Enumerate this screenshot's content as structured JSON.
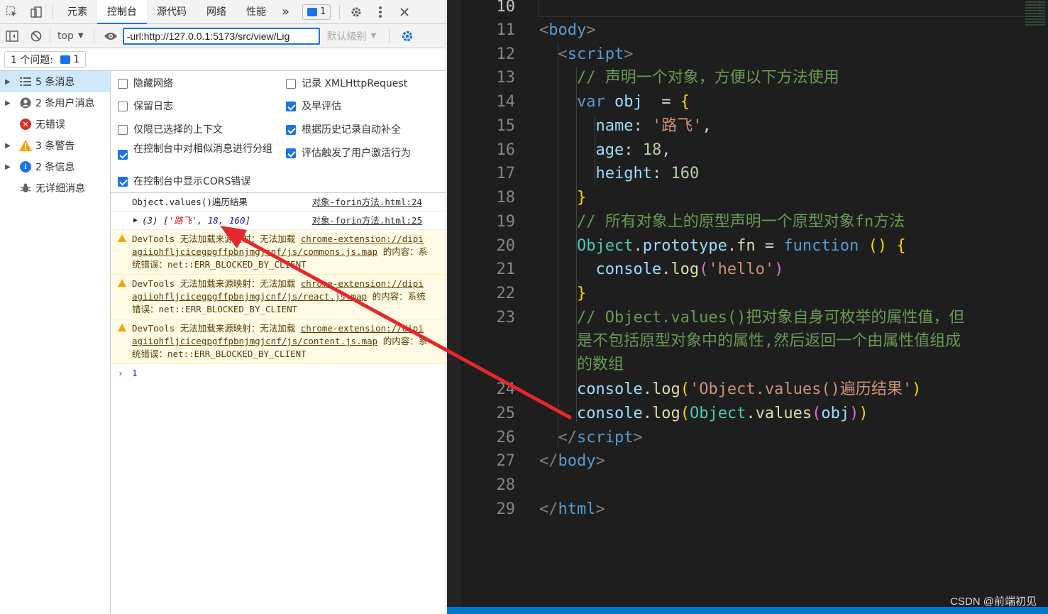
{
  "devtools": {
    "tabs": [
      "元素",
      "控制台",
      "源代码",
      "网络",
      "性能"
    ],
    "active_tab": "控制台",
    "more_tabs": "»",
    "message_badge_count": "1",
    "context": "top",
    "filter_value": "-url:http://127.0.0.1:5173/src/view/Lig",
    "level_label": "默认级别",
    "issues_label": "1 个问题:",
    "issues_count": "1",
    "sidebar": [
      {
        "label": "5 条消息",
        "icon": "list-icon",
        "expandable": true,
        "selected": true
      },
      {
        "label": "2 条用户消息",
        "icon": "user-icon",
        "expandable": true,
        "selected": false
      },
      {
        "label": "无错误",
        "icon": "error-icon",
        "expandable": false,
        "selected": false
      },
      {
        "label": "3 条警告",
        "icon": "warning-icon",
        "expandable": true,
        "selected": false
      },
      {
        "label": "2 条信息",
        "icon": "info-icon",
        "expandable": true,
        "selected": false
      },
      {
        "label": "无详细消息",
        "icon": "bug-icon",
        "expandable": false,
        "selected": false
      }
    ],
    "settings": [
      {
        "label": "隐藏网络",
        "checked": false
      },
      {
        "label": "记录 XMLHttpRequest",
        "checked": false
      },
      {
        "label": "保留日志",
        "checked": false
      },
      {
        "label": "及早评估",
        "checked": true
      },
      {
        "label": "仅限已选择的上下文",
        "checked": false
      },
      {
        "label": "根据历史记录自动补全",
        "checked": true
      },
      {
        "label": "在控制台中对相似消息进行分组",
        "checked": true
      },
      {
        "label": "评估触发了用户激活行为",
        "checked": true
      },
      {
        "label": "在控制台中显示CORS错误",
        "checked": true
      }
    ],
    "console": {
      "log1": {
        "text": "Object.values()遍历结果",
        "source": "对象-forin方法.html:24"
      },
      "log2": {
        "count": "(3)",
        "open": "[",
        "s1": "'路飞'",
        "comma1": ",",
        "n1": "18",
        "comma2": ",",
        "n2": "160",
        "close": "]",
        "source": "对象-forin方法.html:25"
      },
      "warnings": [
        {
          "prefix": "DevTools 无法加载来源映射：无法加载 ",
          "url": "chrome-extension://dipiagiiohfljcicegpgffpbnjmgjcnf/js/commons.js.map",
          "suffix": " 的内容：系统错误：net::ERR_BLOCKED_BY_CLIENT"
        },
        {
          "prefix": "DevTools 无法加载来源映射：无法加载 ",
          "url": "chrome-extension://dipiagiiohfljcicegpgffpbnjmgjcnf/js/react.js.map",
          "suffix": " 的内容：系统错误：net::ERR_BLOCKED_BY_CLIENT"
        },
        {
          "prefix": "DevTools 无法加载来源映射：无法加载 ",
          "url": "chrome-extension://dipiagiiohfljcicegpgffpbnjmgjcnf/js/content.js.map",
          "suffix": " 的内容：系统错误：net::ERR_BLOCKED_BY_CLIENT"
        }
      ],
      "prompt": "›",
      "prompt_value": "1"
    }
  },
  "editor": {
    "lines": [
      {
        "n": "10",
        "segs": []
      },
      {
        "n": "11",
        "segs": [
          [
            "c-tag",
            "<"
          ],
          [
            "c-tagname",
            "body"
          ],
          [
            "c-tag",
            ">"
          ]
        ]
      },
      {
        "n": "12",
        "segs": [
          [
            "c-tag",
            "  <"
          ],
          [
            "c-tagname",
            "script"
          ],
          [
            "c-tag",
            ">"
          ]
        ]
      },
      {
        "n": "13",
        "segs": [
          [
            "c-com",
            "    // 声明一个对象，方便以下方法使用"
          ]
        ]
      },
      {
        "n": "14",
        "segs": [
          [
            "c-kw",
            "    var "
          ],
          [
            "c-var",
            "obj"
          ],
          [
            "",
            "  = "
          ],
          [
            "c-b1",
            "{"
          ]
        ]
      },
      {
        "n": "15",
        "segs": [
          [
            "c-var",
            "      name"
          ],
          [
            "",
            ": "
          ],
          [
            "c-str",
            "'路飞'"
          ],
          [
            "",
            ","
          ]
        ]
      },
      {
        "n": "16",
        "segs": [
          [
            "c-var",
            "      age"
          ],
          [
            "",
            ": "
          ],
          [
            "c-num",
            "18"
          ],
          [
            "",
            ","
          ]
        ]
      },
      {
        "n": "17",
        "segs": [
          [
            "c-var",
            "      height"
          ],
          [
            "",
            ": "
          ],
          [
            "c-num",
            "160"
          ]
        ]
      },
      {
        "n": "18",
        "segs": [
          [
            "c-b1",
            "    }"
          ]
        ]
      },
      {
        "n": "19",
        "segs": [
          [
            "c-com",
            "    // 所有对象上的原型声明一个原型对象fn方法"
          ]
        ]
      },
      {
        "n": "20",
        "segs": [
          [
            "c-cls",
            "    Object"
          ],
          [
            "",
            "."
          ],
          [
            "c-var",
            "prototype"
          ],
          [
            "",
            "."
          ],
          [
            "c-fn",
            "fn"
          ],
          [
            "",
            " = "
          ],
          [
            "c-kw",
            "function"
          ],
          [
            "",
            " "
          ],
          [
            "c-b1",
            "()"
          ],
          [
            "",
            " "
          ],
          [
            "c-b1",
            "{"
          ]
        ]
      },
      {
        "n": "21",
        "segs": [
          [
            "c-var",
            "      console"
          ],
          [
            "",
            "."
          ],
          [
            "c-fn",
            "log"
          ],
          [
            "c-b2",
            "("
          ],
          [
            "c-str",
            "'hello'"
          ],
          [
            "c-b2",
            ")"
          ]
        ]
      },
      {
        "n": "22",
        "segs": [
          [
            "c-b1",
            "    }"
          ]
        ]
      },
      {
        "n": "23",
        "segs": [
          [
            "c-com",
            "    // Object.values()把对象自身可枚举的属性值，但"
          ]
        ]
      },
      {
        "n": "",
        "segs": [
          [
            "c-com",
            "    是不包括原型对象中的属性,然后返回一个由属性值组成"
          ]
        ]
      },
      {
        "n": "",
        "segs": [
          [
            "c-com",
            "    的数组"
          ]
        ]
      },
      {
        "n": "24",
        "segs": [
          [
            "c-var",
            "    console"
          ],
          [
            "",
            "."
          ],
          [
            "c-fn",
            "log"
          ],
          [
            "c-b1",
            "("
          ],
          [
            "c-str",
            "'Object.values()遍历结果'"
          ],
          [
            "c-b1",
            ")"
          ]
        ]
      },
      {
        "n": "25",
        "segs": [
          [
            "c-var",
            "    console"
          ],
          [
            "",
            "."
          ],
          [
            "c-fn",
            "log"
          ],
          [
            "c-b1",
            "("
          ],
          [
            "c-cls",
            "Object"
          ],
          [
            "",
            "."
          ],
          [
            "c-fn",
            "values"
          ],
          [
            "c-b2",
            "("
          ],
          [
            "c-var",
            "obj"
          ],
          [
            "c-b2",
            ")"
          ],
          [
            "c-b1",
            ")"
          ]
        ]
      },
      {
        "n": "26",
        "segs": [
          [
            "c-tag",
            "  </"
          ],
          [
            "c-tagname",
            "script"
          ],
          [
            "c-tag",
            ">"
          ]
        ]
      },
      {
        "n": "27",
        "segs": [
          [
            "c-tag",
            "</"
          ],
          [
            "c-tagname",
            "body"
          ],
          [
            "c-tag",
            ">"
          ]
        ]
      },
      {
        "n": "28",
        "segs": []
      },
      {
        "n": "29",
        "segs": [
          [
            "c-tag",
            "</"
          ],
          [
            "c-tagname",
            "html"
          ],
          [
            "c-tag",
            ">"
          ]
        ]
      }
    ],
    "watermark": "CSDN @前端初见"
  },
  "colors": {
    "accent": "#1a73e8",
    "warning": "#f2a600",
    "error": "#d93025",
    "annotation_arrow": "#e8262a"
  }
}
